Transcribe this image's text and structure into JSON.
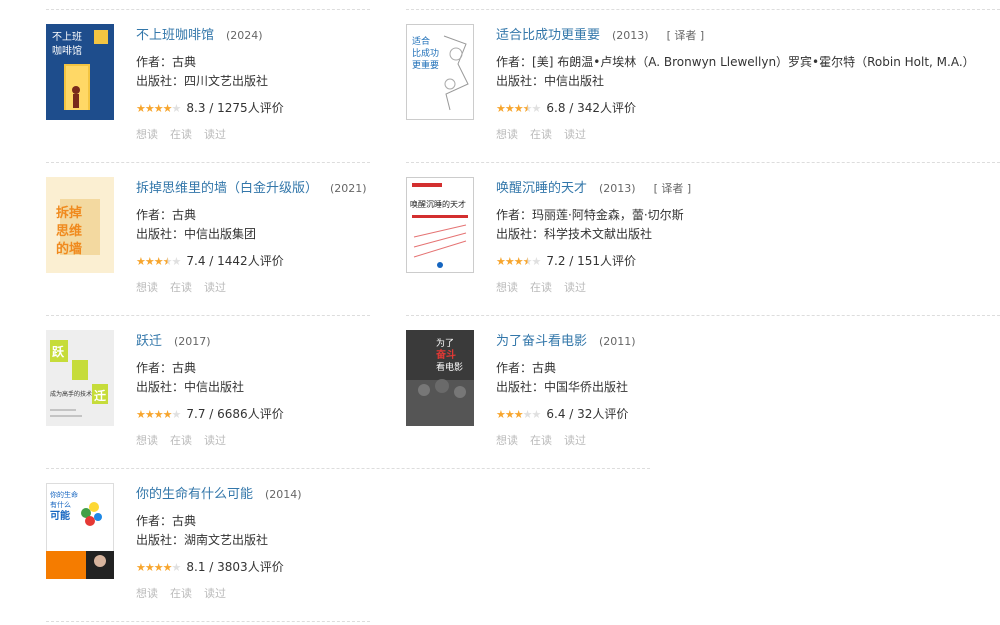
{
  "labels": {
    "author_prefix": "作者：",
    "publisher_prefix": "出版社：",
    "rating_suffix": "人评价",
    "rating_sep": " / "
  },
  "actions": [
    "想读",
    "在读",
    "读过"
  ],
  "colors": {
    "title_link": "#3377aa",
    "star": "#f7a52d",
    "star_empty": "#e0e0e0",
    "muted": "#bbbbbb"
  },
  "books": [
    {
      "title": "不上班咖啡馆",
      "year": "(2024)",
      "translated": "",
      "author": "古典",
      "publisher": "四川文艺出版社",
      "rating": "8.3",
      "rating_count": "1275",
      "stars_value": 4.0,
      "cover_text": "不上班咖啡馆"
    },
    {
      "title": "适合比成功更重要",
      "year": "(2013)",
      "translated": "[ 译者 ]",
      "author": "[美] 布朗温•卢埃林（A. Bronwyn Llewellyn）罗宾•霍尔特（Robin Holt, M.A.）",
      "publisher": "中信出版社",
      "rating": "6.8",
      "rating_count": "342",
      "stars_value": 3.5,
      "cover_text": "适合比成功更重要"
    },
    {
      "title": "拆掉思维里的墙（白金升级版）",
      "year": "(2021)",
      "translated": "",
      "author": "古典",
      "publisher": "中信出版集团",
      "rating": "7.4",
      "rating_count": "1442",
      "stars_value": 3.5,
      "cover_text": "拆掉思维里的墙"
    },
    {
      "title": "唤醒沉睡的天才",
      "year": "(2013)",
      "translated": "[ 译者 ]",
      "author": "玛丽莲·阿特金森，蕾·切尔斯",
      "publisher": "科学技术文献出版社",
      "rating": "7.2",
      "rating_count": "151",
      "stars_value": 3.5,
      "cover_text": "唤醒沉睡的天才"
    },
    {
      "title": "跃迁",
      "year": "(2017)",
      "translated": "",
      "author": "古典",
      "publisher": "中信出版社",
      "rating": "7.7",
      "rating_count": "6686",
      "stars_value": 4.0,
      "cover_text": "跃迁"
    },
    {
      "title": "为了奋斗看电影",
      "year": "(2011)",
      "translated": "",
      "author": "古典",
      "publisher": "中国华侨出版社",
      "rating": "6.4",
      "rating_count": "32",
      "stars_value": 3.0,
      "cover_text": "为了奋斗看电影"
    },
    {
      "title": "你的生命有什么可能",
      "year": "(2014)",
      "translated": "",
      "author": "古典",
      "publisher": "湖南文艺出版社",
      "rating": "8.1",
      "rating_count": "3803",
      "stars_value": 4.0,
      "cover_text": "你的生命有什么可能"
    }
  ]
}
